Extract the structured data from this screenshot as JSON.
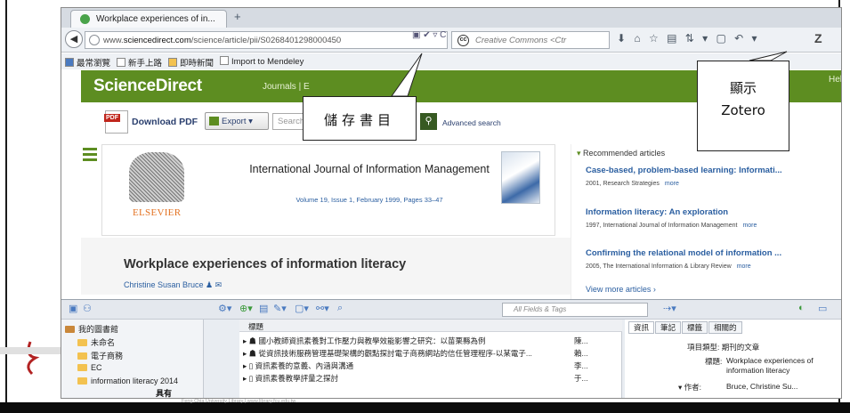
{
  "browser": {
    "tab_title": "Workplace experiences of in...",
    "new_tab": "+",
    "back_label": "◀",
    "url_prefix": "www.",
    "url_domain": "sciencedirect.com",
    "url_path": "/science/article/pii/S0268401298000450",
    "url_tools": "▣ ✔ ▿ C",
    "search_placeholder": "Creative Commons <Ctr",
    "toolbar_icons": "⬇ ⌂ ☆ ▤ ⇅ ▾ ▢ ↶ ▾",
    "zotero_button": "Z"
  },
  "bookmarks": [
    {
      "label": "最常瀏覽"
    },
    {
      "label": "新手上路"
    },
    {
      "label": "即時新聞"
    },
    {
      "label": "Import to Mendeley"
    }
  ],
  "sd": {
    "logo": "ScienceDirect",
    "nav": "Journals  |  E",
    "help": "Help",
    "download_pdf": "Download PDF",
    "export": "Export",
    "search_placeholder": "Search",
    "advanced_search": "Advanced search",
    "elsevier": "ELSEVIER",
    "journal_title": "International Journal of Information Management",
    "volume_line": "Volume 19, Issue 1, February 1999, Pages 33–47",
    "article_title": "Workplace experiences of information literacy",
    "author": "Christine Susan Bruce"
  },
  "recommended": {
    "heading": "Recommended articles",
    "items": [
      {
        "title": "Case-based, problem-based learning: Informati...",
        "meta": "2001, Research Strategies",
        "more": "more"
      },
      {
        "title": "Information literacy: An exploration",
        "meta": "1997, International Journal of Information Management",
        "more": "more"
      },
      {
        "title": "Confirming the relational model of information ...",
        "meta": "2005, The International Information & Library Review",
        "more": "more"
      }
    ],
    "view_more": "View more articles ›"
  },
  "zotero": {
    "search_placeholder": "All Fields & Tags",
    "library": "我的圖書館",
    "collections": [
      "未命名",
      "電子商務",
      "EC",
      "information literacy 2014"
    ],
    "column_title": "標題",
    "items": [
      {
        "title": "國小教師資訊素養對工作壓力與教學效能影響之研究：以苗栗縣為例",
        "year": "陳..."
      },
      {
        "title": "從資訊技術服務管理基礎架構的觀點探討電子商務網站的信任管理程序-以某電子...",
        "year": "賴..."
      },
      {
        "title": "資訊素養的意義、內涵與溝通",
        "year": "李..."
      },
      {
        "title": "資訊素養教學評量之探討",
        "year": "于..."
      }
    ],
    "tabs": [
      "資訊",
      "筆記",
      "標籤",
      "相關的"
    ],
    "item_type_label": "項目類型: 期刊的文章",
    "title_label": "標題:",
    "title_value": "Workplace experiences of information literacy",
    "author_label": "作者:",
    "author_value": "Bruce, Christine Su..."
  },
  "annotations": {
    "bookmark": "儲存書目",
    "zotero_line1": "顯示",
    "zotero_line2": "Zotero"
  },
  "footer": {
    "text": "Feng Chia University Library | www.library.fcu.edu.tw",
    "glyph": "具有"
  }
}
